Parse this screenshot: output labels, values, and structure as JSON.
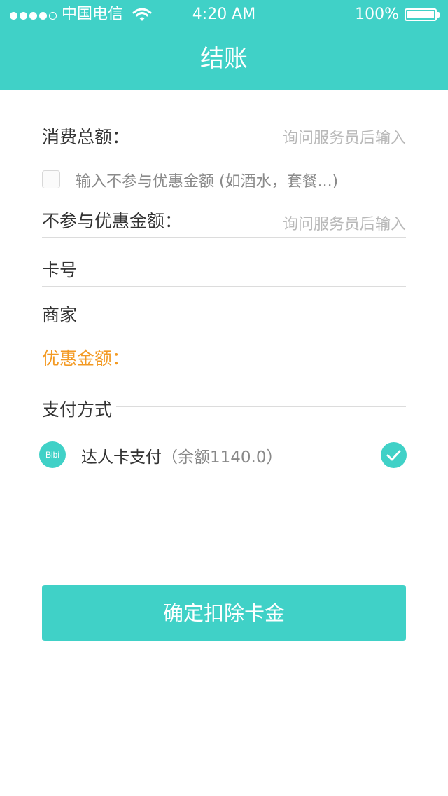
{
  "status_bar": {
    "carrier": "中国电信",
    "time": "4:20 AM",
    "battery": "100%",
    "signal_bars": 4,
    "signal_max": 5
  },
  "header": {
    "title": "结账"
  },
  "form": {
    "total_label": "消费总额：",
    "total_placeholder": "询问服务员后输入",
    "exclude_checkbox_label": "输入不参与优惠金额 (如酒水，套餐...)",
    "excluded_label": "不参与优惠金额：",
    "excluded_placeholder": "询问服务员后输入",
    "card_label": "卡号",
    "merchant_label": "商家",
    "discount_label": "优惠金额："
  },
  "payment": {
    "section_title": "支付方式",
    "method_logo": "Bibi",
    "method_label": "达人卡支付",
    "method_balance": "（余额1140.0）",
    "selected": true
  },
  "actions": {
    "confirm_label": "确定扣除卡金"
  },
  "colors": {
    "accent": "#40d1c7",
    "highlight": "#f39a23"
  },
  "icons": {
    "signal": "signal-dots-icon",
    "wifi": "wifi-icon",
    "battery": "battery-icon",
    "checkbox": "checkbox-icon",
    "logo": "bibi-logo-icon",
    "check": "checkmark-circle-icon"
  }
}
